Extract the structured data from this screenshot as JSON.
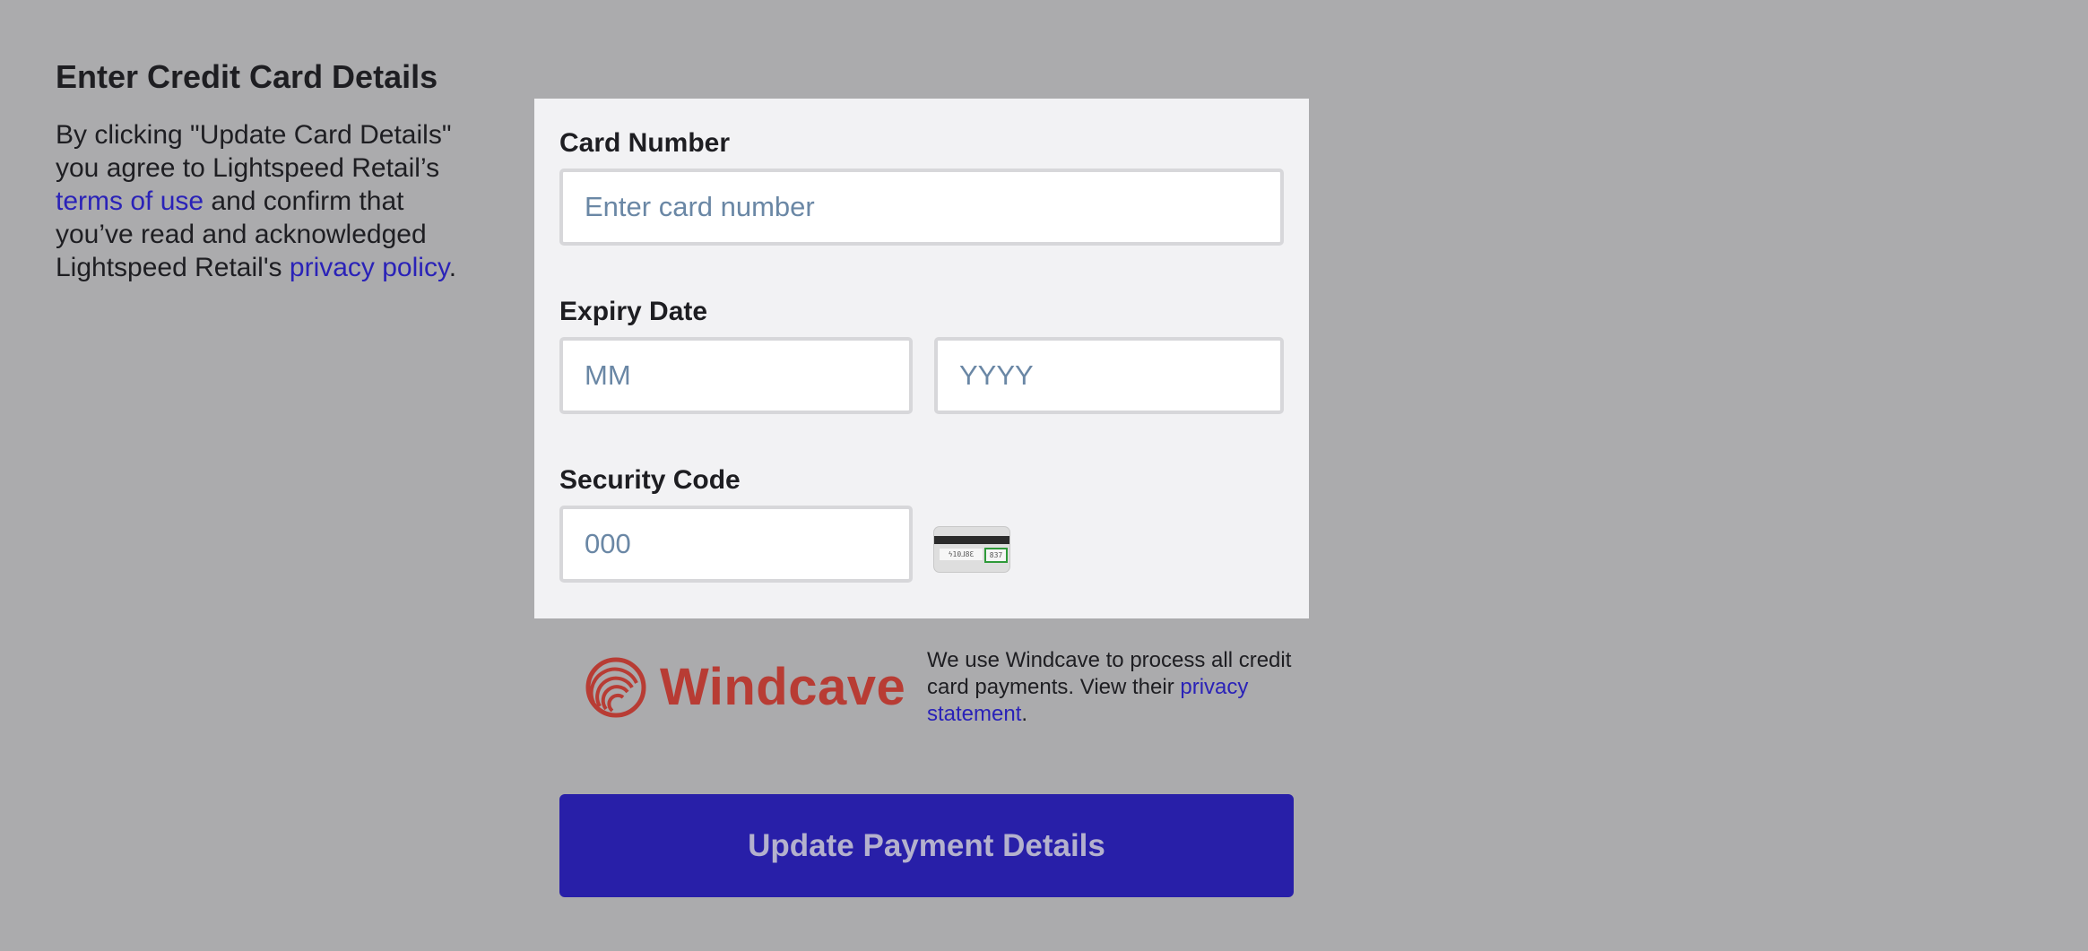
{
  "left_panel": {
    "title": "Enter Credit Card Details",
    "consent": {
      "before_terms": "By clicking \"Update Card Details\" you agree to Lightspeed Retail’s ",
      "terms_link": "terms of use",
      "middle": " and confirm that you’ve read and acknowledged Lightspeed Retail's ",
      "privacy_link": "privacy policy",
      "end": "."
    }
  },
  "form": {
    "card_number": {
      "label": "Card Number",
      "placeholder": "Enter card number",
      "value": ""
    },
    "expiry": {
      "label": "Expiry Date",
      "month_placeholder": "MM",
      "year_placeholder": "YYYY"
    },
    "security_code": {
      "label": "Security Code",
      "placeholder": "000",
      "icon": "card-back-cvv-icon"
    }
  },
  "processor": {
    "name": "Windcave",
    "text_before": "We use Windcave to process all credit card payments. View their ",
    "privacy_link": "privacy statement",
    "text_after": "."
  },
  "submit": {
    "label": "Update Payment Details"
  },
  "colors": {
    "background": "#ababad",
    "form_background": "#f2f2f4",
    "link": "#2a22b8",
    "button": "#281fa8",
    "button_text": "#b4b1cd",
    "brand_red": "#b83c34",
    "placeholder": "#6a87a5"
  }
}
